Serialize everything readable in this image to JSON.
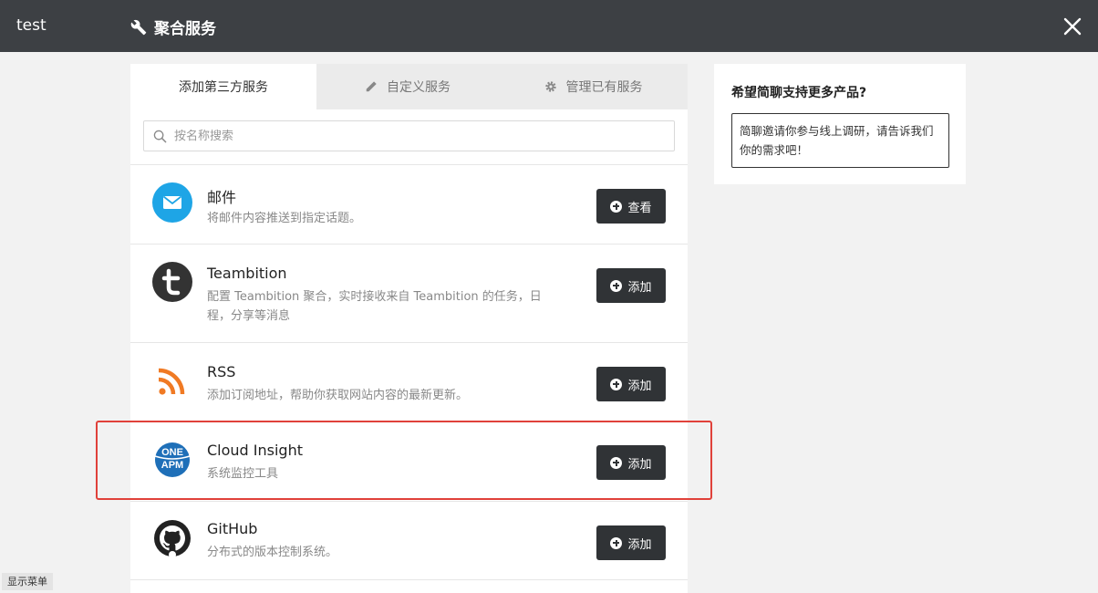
{
  "header": {
    "workspace": "test",
    "title": "聚合服务"
  },
  "tabs": [
    {
      "label": "添加第三方服务",
      "active": true
    },
    {
      "label": "自定义服务",
      "active": false
    },
    {
      "label": "管理已有服务",
      "active": false
    }
  ],
  "search": {
    "placeholder": "按名称搜索",
    "value": ""
  },
  "services": [
    {
      "name": "邮件",
      "desc": "将邮件内容推送到指定话题。",
      "action": "查看",
      "icon": "mail-icon"
    },
    {
      "name": "Teambition",
      "desc": "配置 Teambition 聚合，实时接收来自 Teambition 的任务，日程，分享等消息",
      "action": "添加",
      "icon": "teambition-icon"
    },
    {
      "name": "RSS",
      "desc": "添加订阅地址，帮助你获取网站内容的最新更新。",
      "action": "添加",
      "icon": "rss-icon"
    },
    {
      "name": "Cloud Insight",
      "desc": "系统监控工具",
      "action": "添加",
      "icon": "oneapm-icon"
    },
    {
      "name": "GitHub",
      "desc": "分布式的版本控制系统。",
      "action": "添加",
      "icon": "github-icon"
    }
  ],
  "logo_text": {
    "oneapm_top": "ONE",
    "oneapm_bottom": "APM"
  },
  "sidebar": {
    "question": "希望简聊支持更多产品?",
    "invite": "简聊邀请你参与线上调研，请告诉我们你的需求吧！"
  },
  "footer": {
    "menu_toggle": "显示菜单"
  },
  "colors": {
    "header_bg": "#3d4044",
    "button_bg": "#303336",
    "highlight": "#e0413a",
    "mail_blue": "#1ea5e6",
    "rss_orange": "#f07a24",
    "oneapm_blue": "#1e6fb8"
  }
}
